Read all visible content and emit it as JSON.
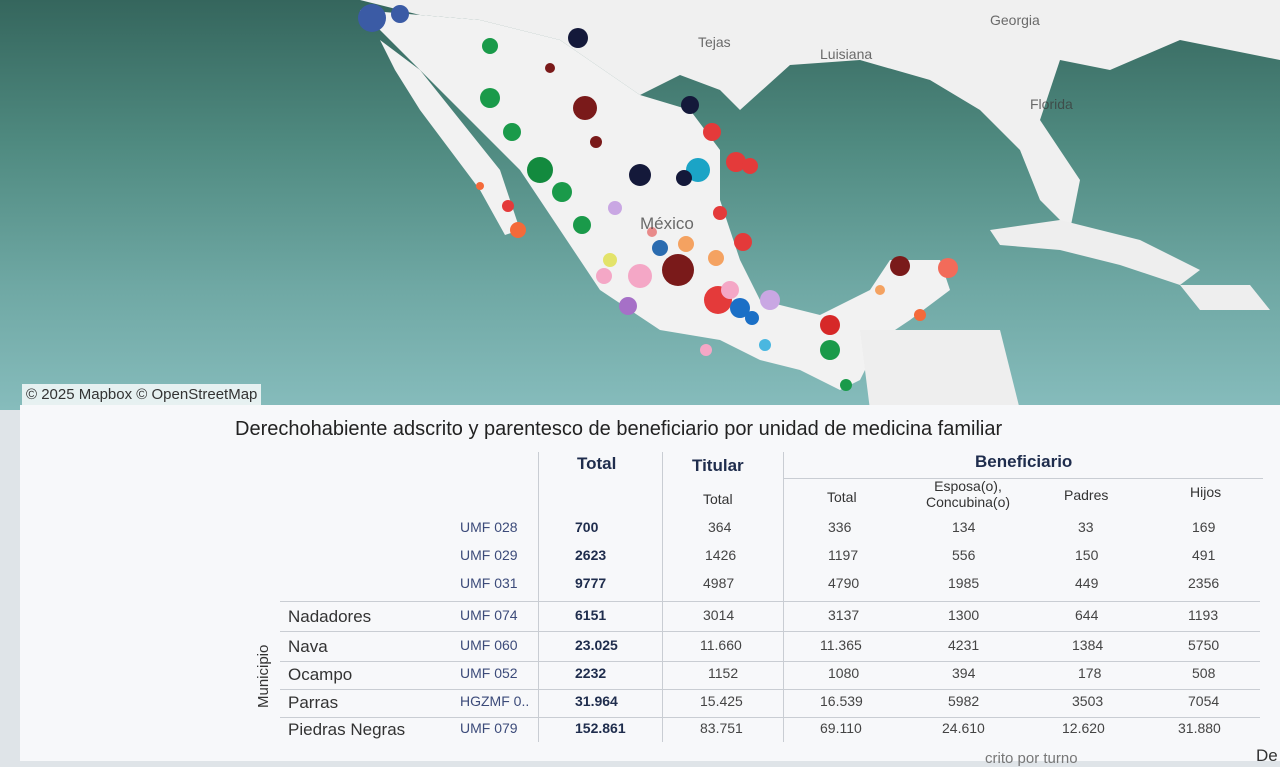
{
  "map": {
    "labels": {
      "tejas": "Tejas",
      "luisiana": "Luisiana",
      "georgia": "Georgia",
      "florida": "Florida",
      "mexico": "México"
    },
    "attribution": "© 2025 Mapbox  © OpenStreetMap"
  },
  "table": {
    "title": "Derechohabiente adscrito y parentesco de beneficiario por unidad de medicina familiar",
    "headers": {
      "total": "Total",
      "titular": "Titular",
      "beneficiario": "Beneficiario"
    },
    "subheaders": {
      "titular_total": "Total",
      "benef_total": "Total",
      "esposa": "Esposa(o),\nConcubina(o)",
      "padres": "Padres",
      "hijos": "Hijos"
    },
    "vertical_label": "Municipio",
    "rows": [
      {
        "municipio": "",
        "umf": "UMF 028",
        "total": "700",
        "titular": "364",
        "benef_total": "336",
        "esposa": "134",
        "padres": "33",
        "hijos": "169"
      },
      {
        "municipio": "",
        "umf": "UMF 029",
        "total": "2623",
        "titular": "1426",
        "benef_total": "1197",
        "esposa": "556",
        "padres": "150",
        "hijos": "491"
      },
      {
        "municipio": "",
        "umf": "UMF 031",
        "total": "9777",
        "titular": "4987",
        "benef_total": "4790",
        "esposa": "1985",
        "padres": "449",
        "hijos": "2356"
      },
      {
        "municipio": "Nadadores",
        "umf": "UMF 074",
        "total": "6151",
        "titular": "3014",
        "benef_total": "3137",
        "esposa": "1300",
        "padres": "644",
        "hijos": "1193"
      },
      {
        "municipio": "Nava",
        "umf": "UMF 060",
        "total": "23.025",
        "titular": "11.660",
        "benef_total": "11.365",
        "esposa": "4231",
        "padres": "1384",
        "hijos": "5750"
      },
      {
        "municipio": "Ocampo",
        "umf": "UMF 052",
        "total": "2232",
        "titular": "1152",
        "benef_total": "1080",
        "esposa": "394",
        "padres": "178",
        "hijos": "508"
      },
      {
        "municipio": "Parras",
        "umf": "HGZMF 0..",
        "total": "31.964",
        "titular": "15.425",
        "benef_total": "16.539",
        "esposa": "5982",
        "padres": "3503",
        "hijos": "7054"
      },
      {
        "municipio": "Piedras Negras",
        "umf": "UMF 079",
        "total": "152.861",
        "titular": "83.751",
        "benef_total": "69.110",
        "esposa": "24.610",
        "padres": "12.620",
        "hijos": "31.880"
      }
    ],
    "footer_text": "crito por turno",
    "footer_right": "De"
  }
}
